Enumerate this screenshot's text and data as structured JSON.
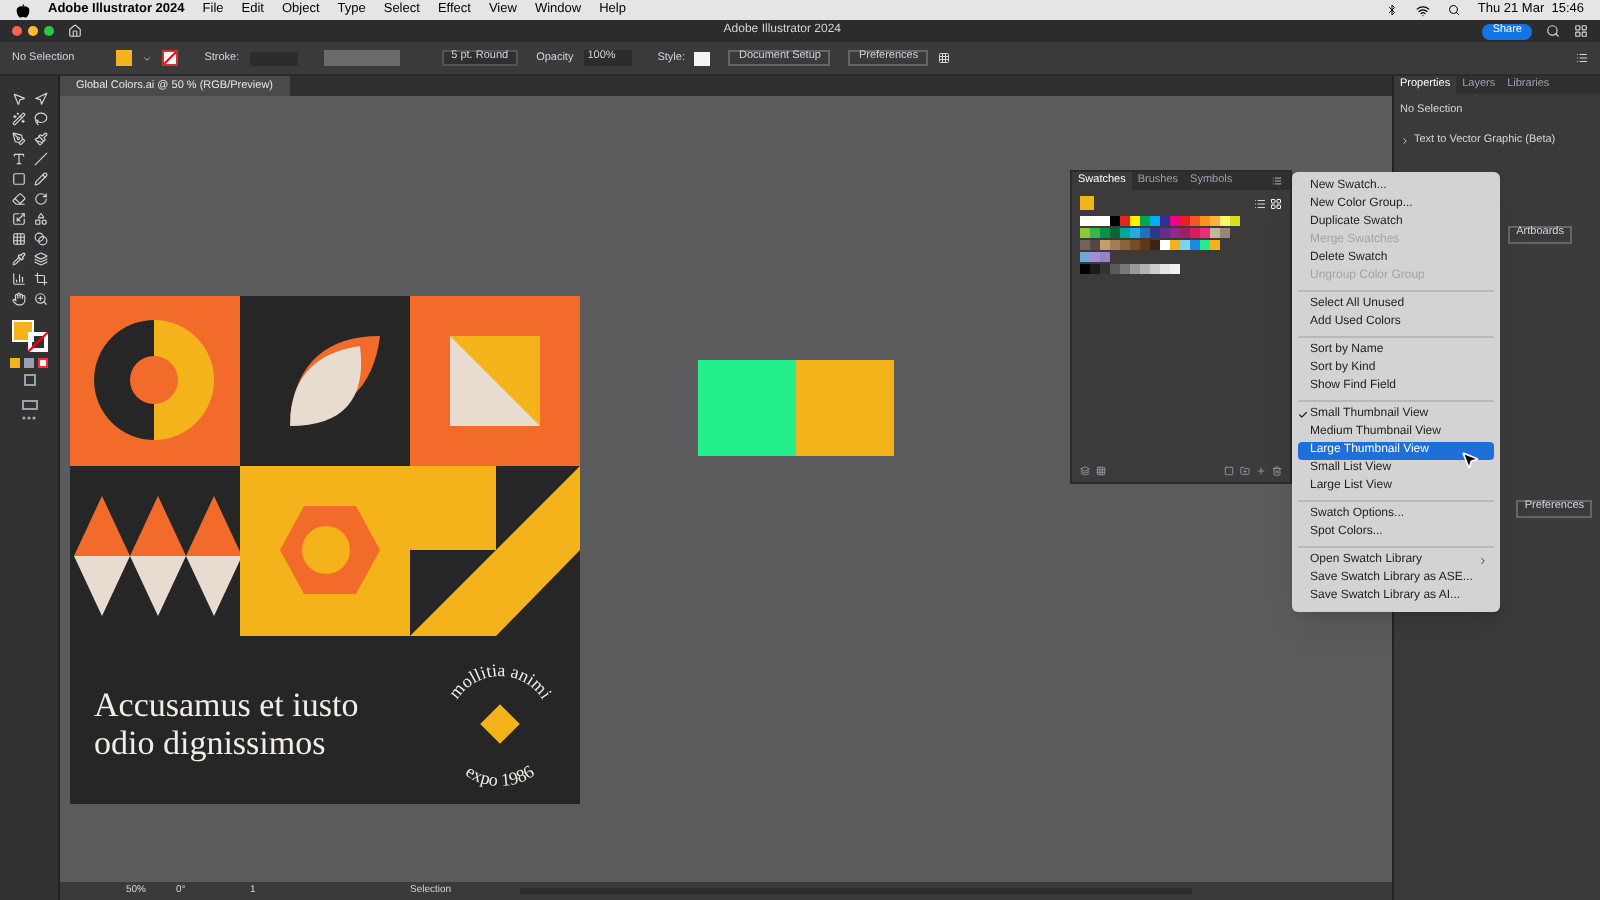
{
  "menubar": {
    "app": "Adobe Illustrator 2024",
    "items": [
      "File",
      "Edit",
      "Object",
      "Type",
      "Select",
      "Effect",
      "View",
      "Window",
      "Help"
    ],
    "clock": "Thu 21 Mar  15:46"
  },
  "window": {
    "title": "Adobe Illustrator 2024",
    "share": "Share"
  },
  "control_bar": {
    "selection": "No Selection",
    "stroke_label": "Stroke:",
    "brush": "5 pt. Round",
    "opacity_label": "Opacity",
    "opacity": "100%",
    "style_label": "Style:",
    "buttons": [
      "Document Setup",
      "Preferences"
    ]
  },
  "document_tab": {
    "title": "Global Colors.ai @ 50 % (RGB/Preview)"
  },
  "artwork": {
    "headline": [
      "Accusamus et iusto",
      "odio dignissimos"
    ],
    "badge_text": "mollitia animi",
    "badge_year": "expo 1986"
  },
  "canvas_shapes": [
    {
      "color": "#23f08a"
    },
    {
      "color": "#f5b31b"
    }
  ],
  "swatches_panel": {
    "tabs": [
      {
        "label": "Swatches",
        "selected": true
      },
      {
        "label": "Brushes",
        "selected": false
      },
      {
        "label": "Symbols",
        "selected": false
      }
    ],
    "rows": [
      [
        {
          "color": "#ffffff"
        },
        {
          "color": "#ffffff"
        },
        {
          "color": "#ffffff"
        },
        {
          "color": "#000000"
        },
        {
          "color": "#e5231f"
        },
        {
          "color": "#fff200"
        },
        {
          "color": "#00a651"
        },
        {
          "color": "#00aeef"
        },
        {
          "color": "#2e3192"
        },
        {
          "color": "#ec008c"
        },
        {
          "color": "#ed1c24"
        },
        {
          "color": "#f15a24"
        },
        {
          "color": "#f7941d"
        },
        {
          "color": "#fbb040"
        },
        {
          "color": "#fff568"
        },
        {
          "color": "#d7df23"
        }
      ],
      [
        {
          "color": "#8dc63f"
        },
        {
          "color": "#39b54a"
        },
        {
          "color": "#009444"
        },
        {
          "color": "#006838"
        },
        {
          "color": "#00a79d"
        },
        {
          "color": "#27aae1"
        },
        {
          "color": "#1c75bc"
        },
        {
          "color": "#2b388f"
        },
        {
          "color": "#662d91"
        },
        {
          "color": "#92278f"
        },
        {
          "color": "#9e1f63"
        },
        {
          "color": "#da1c5c"
        },
        {
          "color": "#ee2a7b"
        },
        {
          "color": "#c2b59b"
        },
        {
          "color": "#998675"
        }
      ],
      [
        {
          "color": "#736357"
        },
        {
          "color": "#534741"
        },
        {
          "color": "#c69c6d"
        },
        {
          "color": "#a67c52"
        },
        {
          "color": "#8c6239"
        },
        {
          "color": "#754c24"
        },
        {
          "color": "#603913"
        },
        {
          "color": "#3c2415"
        },
        {
          "color": "#ffffff"
        },
        {
          "color": "#f5b31b"
        },
        {
          "color": "#7fd3e8"
        },
        {
          "color": "#1e88e5"
        },
        {
          "color": "#23f08a"
        },
        {
          "color": "#f5b31b"
        }
      ],
      [
        {
          "color": "#6aa8d8"
        },
        {
          "color": "#a08fd0"
        },
        {
          "color": "#9b7fc8"
        }
      ],
      [
        {
          "color": "#000000"
        },
        {
          "color": "#1c1c1c"
        },
        {
          "color": "#333333"
        },
        {
          "color": "#5a5a5a"
        },
        {
          "color": "#777777"
        },
        {
          "color": "#999999"
        },
        {
          "color": "#b3b3b3"
        },
        {
          "color": "#cccccc"
        },
        {
          "color": "#e6e6e6"
        },
        {
          "color": "#f2f2f2"
        }
      ]
    ]
  },
  "context_menu": {
    "groups": [
      [
        {
          "label": "New Swatch...",
          "disabled": false,
          "checked": false,
          "selected": false,
          "submenu": false
        },
        {
          "label": "New Color Group...",
          "disabled": false,
          "checked": false,
          "selected": false,
          "submenu": false
        },
        {
          "label": "Duplicate Swatch",
          "disabled": false,
          "checked": false,
          "selected": false,
          "submenu": false
        },
        {
          "label": "Merge Swatches",
          "disabled": true,
          "checked": false,
          "selected": false,
          "submenu": false
        },
        {
          "label": "Delete Swatch",
          "disabled": false,
          "checked": false,
          "selected": false,
          "submenu": false
        },
        {
          "label": "Ungroup Color Group",
          "disabled": true,
          "checked": false,
          "selected": false,
          "submenu": false
        }
      ],
      [
        {
          "label": "Select All Unused",
          "disabled": false,
          "checked": false,
          "selected": false,
          "submenu": false
        },
        {
          "label": "Add Used Colors",
          "disabled": false,
          "checked": false,
          "selected": false,
          "submenu": false
        }
      ],
      [
        {
          "label": "Sort by Name",
          "disabled": false,
          "checked": false,
          "selected": false,
          "submenu": false
        },
        {
          "label": "Sort by Kind",
          "disabled": false,
          "checked": false,
          "selected": false,
          "submenu": false
        },
        {
          "label": "Show Find Field",
          "disabled": false,
          "checked": false,
          "selected": false,
          "submenu": false
        }
      ],
      [
        {
          "label": "Small Thumbnail View",
          "disabled": false,
          "checked": true,
          "selected": false,
          "submenu": false
        },
        {
          "label": "Medium Thumbnail View",
          "disabled": false,
          "checked": false,
          "selected": false,
          "submenu": false
        },
        {
          "label": "Large Thumbnail View",
          "disabled": false,
          "checked": false,
          "selected": true,
          "submenu": false
        },
        {
          "label": "Small List View",
          "disabled": false,
          "checked": false,
          "selected": false,
          "submenu": false
        },
        {
          "label": "Large List View",
          "disabled": false,
          "checked": false,
          "selected": false,
          "submenu": false
        }
      ],
      [
        {
          "label": "Swatch Options...",
          "disabled": false,
          "checked": false,
          "selected": false,
          "submenu": false
        },
        {
          "label": "Spot Colors...",
          "disabled": false,
          "checked": false,
          "selected": false,
          "submenu": false
        }
      ],
      [
        {
          "label": "Open Swatch Library",
          "disabled": false,
          "checked": false,
          "selected": false,
          "submenu": true
        },
        {
          "label": "Save Swatch Library as ASE...",
          "disabled": false,
          "checked": false,
          "selected": false,
          "submenu": false
        },
        {
          "label": "Save Swatch Library as AI...",
          "disabled": false,
          "checked": false,
          "selected": false,
          "submenu": false
        }
      ]
    ]
  },
  "right_panel": {
    "tabs": [
      {
        "label": "Properties",
        "selected": true
      },
      {
        "label": "Layers",
        "selected": false
      },
      {
        "label": "Libraries",
        "selected": false
      }
    ],
    "selection": "No Selection",
    "section": "Text to Vector Graphic (Beta)",
    "artboards_button": "Artboards",
    "preferences_button": "Preferences"
  },
  "status_bar": {
    "zoom": "50%",
    "rotation": "0°",
    "artboard": "1",
    "tool": "Selection"
  }
}
